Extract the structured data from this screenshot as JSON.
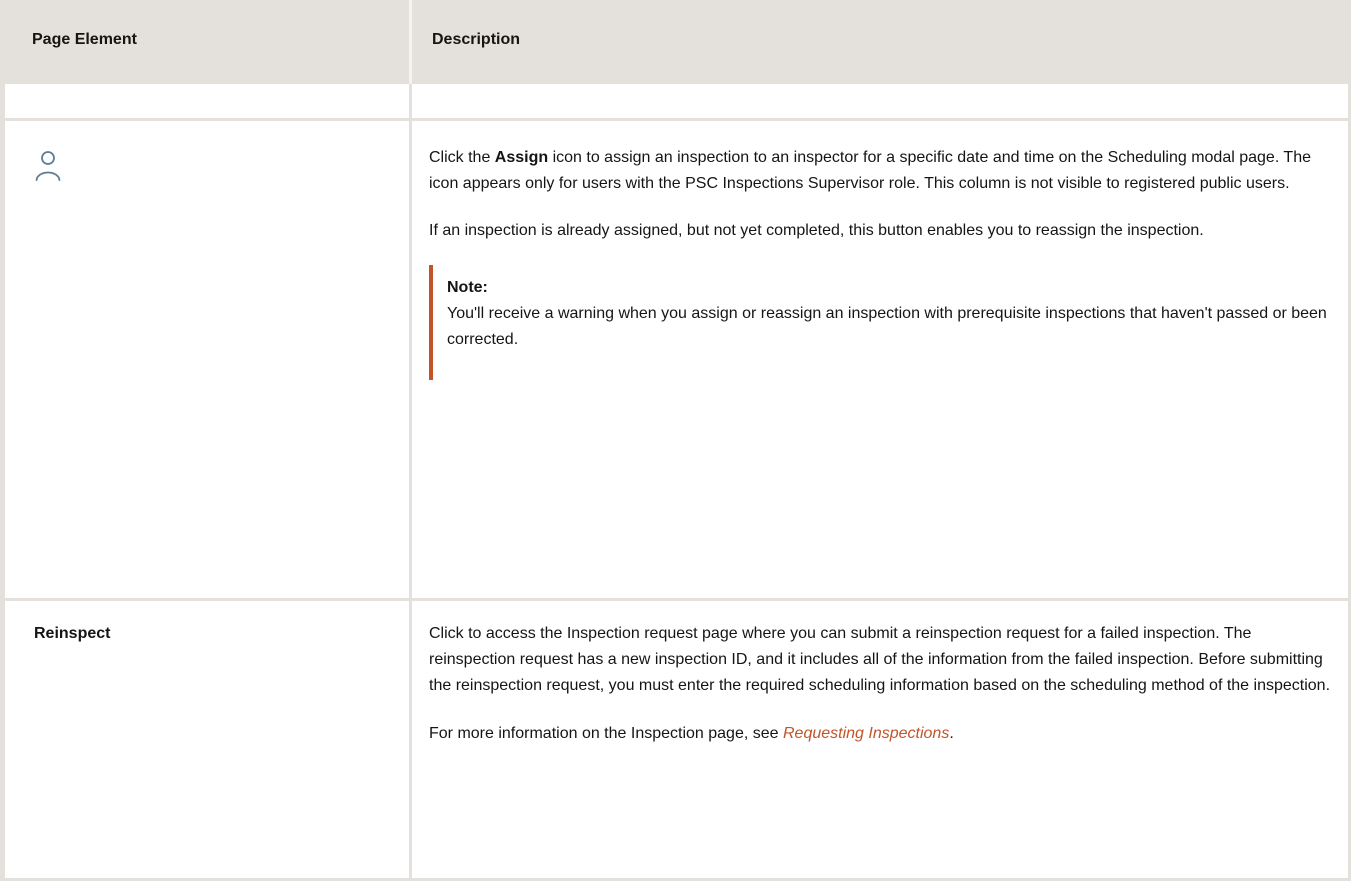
{
  "table": {
    "headers": [
      "Page Element",
      "Description"
    ],
    "rows": {
      "assign": {
        "icon": "person-icon",
        "desc1_pre": "Click the ",
        "desc1_bold": "Assign",
        "desc1_post": " icon to assign an inspection to an inspector for a specific date and time on the Scheduling modal page. The icon appears only for users with the PSC Inspections Supervisor role. This column is not visible to registered public users.",
        "desc2": "If an inspection is already assigned, but not yet completed, this button enables you to reassign the inspection.",
        "note_title": "Note:",
        "note_text": "You'll receive a warning when you assign or reassign an inspection with prerequisite inspections that haven't passed or been corrected."
      },
      "reinspect": {
        "label": "Reinspect",
        "desc1": "Click to access the Inspection request page where you can submit a reinspection request for a failed inspection. The reinspection request has a new inspection ID, and it includes all of the information from the failed inspection. Before submitting the reinspection request, you must enter the required scheduling information based on the scheduling method of the inspection.",
        "desc2_pre": "For more information on the Inspection page, see ",
        "desc2_link": "Requesting Inspections",
        "desc2_post": "."
      }
    }
  },
  "colors": {
    "header_bg": "#e4e1dd",
    "accent": "#c2542a",
    "icon": "#5f7d95"
  }
}
